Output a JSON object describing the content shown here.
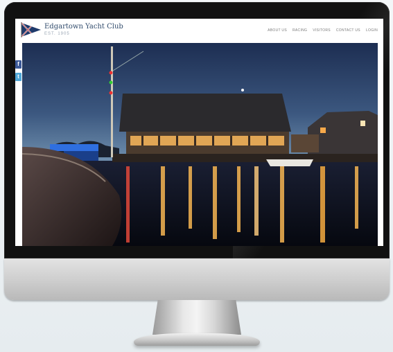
{
  "site": {
    "name": "Edgartown Yacht Club",
    "tagline": "EST. 1905"
  },
  "nav": {
    "items": [
      "ABOUT US",
      "RACING",
      "VISITORS",
      "CONTACT US",
      "LOGIN"
    ]
  },
  "social": {
    "facebook_glyph": "f",
    "twitter_glyph": "t"
  },
  "carousel": {
    "slide_count": 4,
    "active_index": 0
  },
  "colors": {
    "brand": "#2f4a6b",
    "facebook": "#3b5998",
    "twitter": "#4fa7d8"
  }
}
